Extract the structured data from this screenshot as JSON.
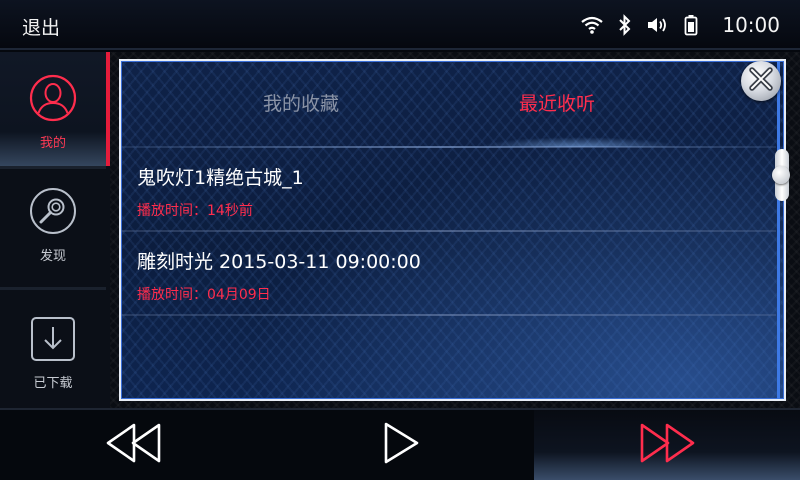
{
  "status_bar": {
    "exit_label": "退出",
    "time": "10:00",
    "icons": [
      "wifi-icon",
      "bluetooth-icon",
      "volume-icon",
      "battery-icon"
    ]
  },
  "sidebar": {
    "items": [
      {
        "label": "我的",
        "icon": "user-icon",
        "active": true
      },
      {
        "label": "发现",
        "icon": "discover-search-icon",
        "active": false
      },
      {
        "label": "已下载",
        "icon": "download-icon",
        "active": false
      }
    ]
  },
  "modal": {
    "tabs": [
      {
        "label": "我的收藏",
        "active": false
      },
      {
        "label": "最近收听",
        "active": true
      }
    ],
    "items": [
      {
        "title": "鬼吹灯1精绝古城_1",
        "played": "播放时间：14秒前"
      },
      {
        "title": "雕刻时光 2015-03-11 09:00:00",
        "played": "播放时间：04月09日"
      }
    ]
  },
  "controls": {
    "icons": [
      "rewind-icon",
      "play-icon",
      "fast-forward-icon"
    ]
  },
  "colors": {
    "accent": "#e51c3b",
    "modal_bg": "#0f2248",
    "text": "#ffffff"
  }
}
